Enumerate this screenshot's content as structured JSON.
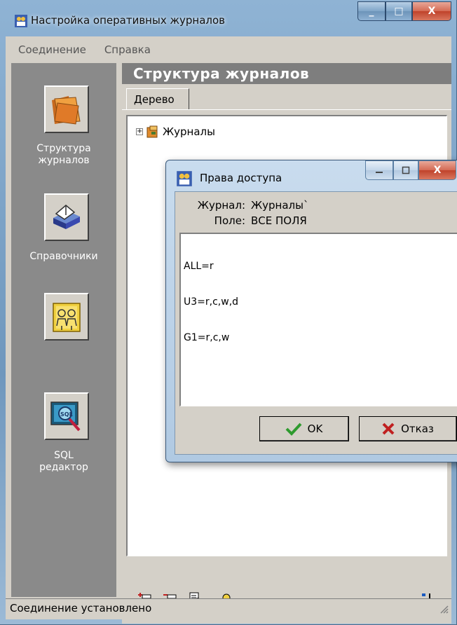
{
  "window": {
    "title": "Настройка оперативных журналов",
    "buttons": {
      "minimize": "_",
      "maximize": "□",
      "close": "X"
    }
  },
  "menu": {
    "items": [
      "Соединение",
      "Справка"
    ]
  },
  "left_panel": {
    "items": [
      {
        "label": "Структура\nжурналов",
        "icon": "folder-icon"
      },
      {
        "label": "Справочники",
        "icon": "books-icon"
      },
      {
        "label": "",
        "icon": "users-icon"
      },
      {
        "label": "SQL\nредактор",
        "icon": "sql-icon"
      }
    ]
  },
  "main": {
    "header": "Структура журналов",
    "tab": "Дерево",
    "tree": {
      "root_label": "Журналы",
      "expander": "+"
    }
  },
  "dialog": {
    "title": "Права доступа",
    "journal_label": "Журнал:",
    "journal_value": "Журналы`",
    "field_label": "Поле:",
    "field_value": "ВСЕ ПОЛЯ",
    "rights_lines": [
      "ALL=r",
      "U3=r,c,w,d",
      "G1=r,c,w"
    ],
    "ok_label": "OK",
    "cancel_label": "Отказ"
  },
  "status": {
    "text": "Соединение установлено"
  },
  "colors": {
    "accent_orange": "#e08a2c",
    "ok_green": "#2e9a2e",
    "cancel_red": "#c02020"
  }
}
